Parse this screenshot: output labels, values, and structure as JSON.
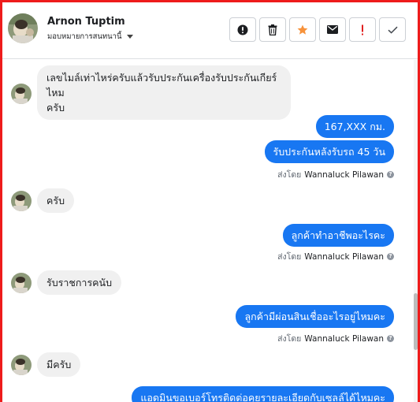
{
  "header": {
    "contact_name": "Arnon Tuptim",
    "assign_label": "มอบหมายการสนทนานี้",
    "tools": [
      {
        "icon": "alert-circle-icon"
      },
      {
        "icon": "trash-icon"
      },
      {
        "icon": "star-icon",
        "color": "#f7923b"
      },
      {
        "icon": "envelope-icon"
      },
      {
        "icon": "exclamation-icon",
        "color": "#e02020"
      },
      {
        "icon": "checkmark-icon"
      }
    ]
  },
  "messages": {
    "m1": "เลขไมล์เท่าไหร่ครับแล้วรับประกันเครื่องรับประกันเกียร์ไหม",
    "m1b": "ครับ",
    "m2": "167,XXX  กม.",
    "m3": "รับประกันหลังรับรถ 45 วัน",
    "m4": "ครับ",
    "m5": "ลูกค้าทำอาชีพอะไรคะ",
    "m6": "รับราชการคนับ",
    "m7": "ลูกค้ามีผ่อนสินเชื่ออะไรอยู่ไหมคะ",
    "m8": "มีครับ",
    "m9": "แอดมินขอเบอร์โทรติดต่อคุยรายละเอียดกับเซลล์ได้ไหมคะ"
  },
  "sent_by": {
    "prefix": "ส่งโดย",
    "name": "Wannaluck Pilawan",
    "help": "?"
  },
  "colors": {
    "outgoing_bubble": "#1877f2",
    "incoming_bubble": "#f0f0f0",
    "frame_border": "#ee1c1c"
  }
}
